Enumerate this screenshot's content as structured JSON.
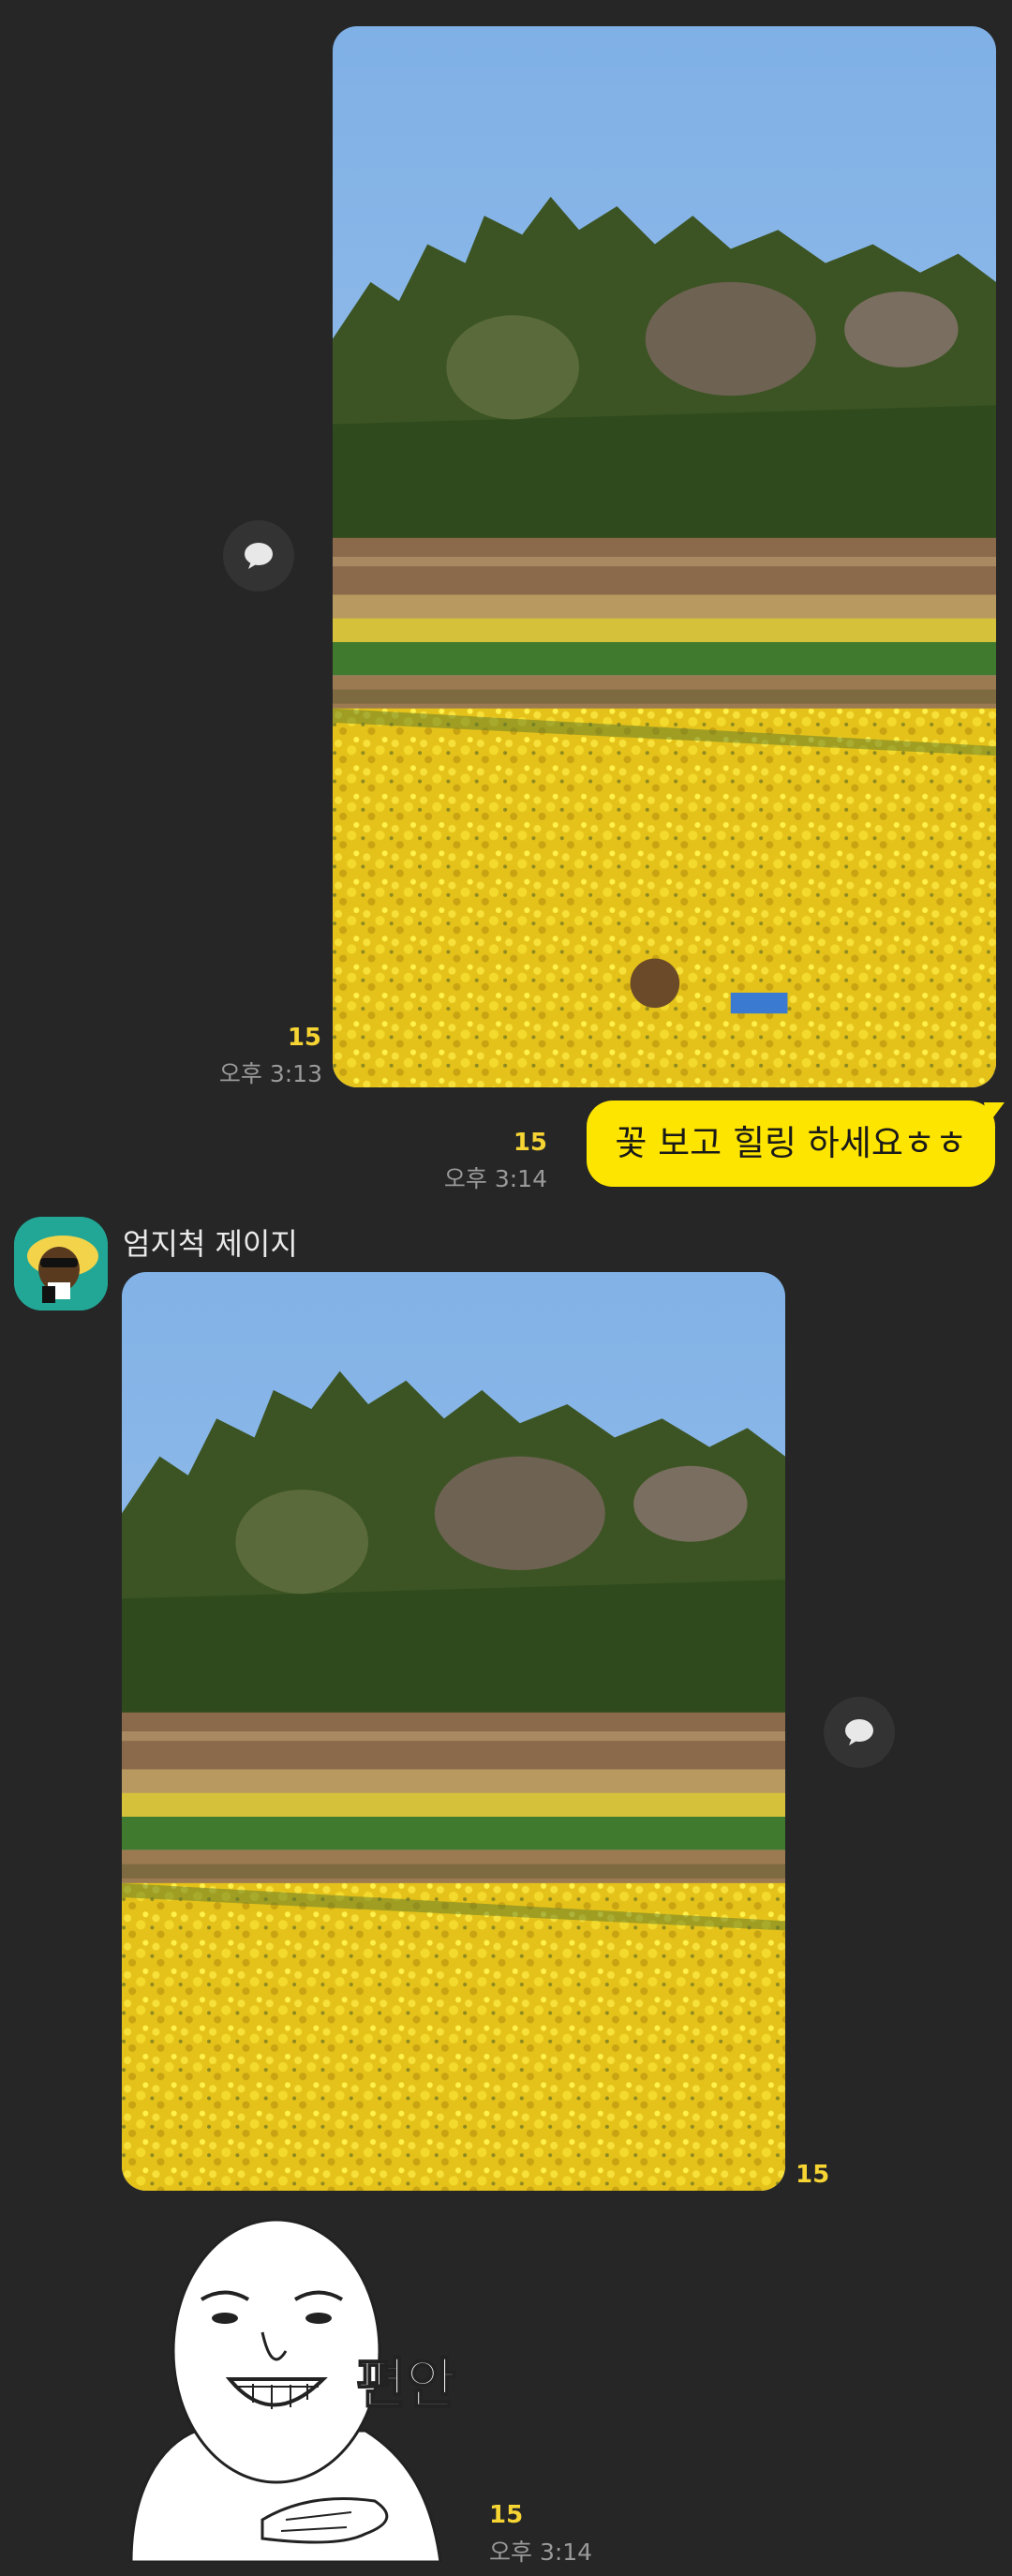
{
  "messages": {
    "photo1": {
      "unread": "15",
      "time": "오후 3:13"
    },
    "text1": {
      "text": "꽃 보고 힐링 하세요ㅎㅎ",
      "unread": "15",
      "time": "오후 3:14"
    },
    "sender": {
      "name": "엄지척 제이지"
    },
    "photo2": {
      "unread": "15"
    },
    "sticker": {
      "caption": "편안",
      "unread": "15",
      "time": "오후 3:14"
    }
  },
  "icons": {
    "share": "speech-bubble-icon",
    "avatar": "jay-g-character-icon"
  },
  "colors": {
    "background": "#262626",
    "my_bubble": "#fee500",
    "unread": "#f5d433",
    "time": "#9a9a9a"
  }
}
